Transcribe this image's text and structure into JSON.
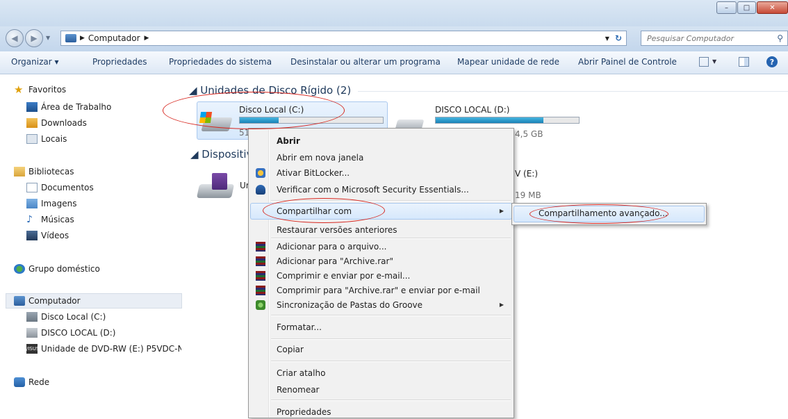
{
  "window": {
    "controls": {
      "minimize": "–",
      "maximize": "□",
      "close": "✕"
    }
  },
  "address": {
    "path": [
      "Computador"
    ],
    "search_placeholder": "Pesquisar Computador"
  },
  "toolbar": {
    "organize": "Organizar ▾",
    "properties": "Propriedades",
    "system_properties": "Propriedades do sistema",
    "uninstall": "Desinstalar ou alterar um programa",
    "map_drive": "Mapear unidade de rede",
    "control_panel": "Abrir Painel de Controle"
  },
  "nav": {
    "favorites": "Favoritos",
    "desktop": "Área de Trabalho",
    "downloads": "Downloads",
    "places": "Locais",
    "libraries": "Bibliotecas",
    "documents": "Documentos",
    "images": "Imagens",
    "music": "Músicas",
    "videos": "Vídeos",
    "homegroup": "Grupo doméstico",
    "computer": "Computador",
    "drive_c": "Disco Local (C:)",
    "drive_d": "DISCO LOCAL (D:)",
    "drive_e": "Unidade de DVD-RW (E:) P5VDC-N",
    "network": "Rede"
  },
  "content": {
    "hard_drives_header": "◢ Unidades de Disco Rígido (2)",
    "removable_header": "◢ Dispositiv",
    "drive_c": {
      "name": "Disco Local (C:)",
      "free_partial": "51",
      "usage_fraction": 0.27
    },
    "drive_d": {
      "name": "DISCO LOCAL (D:)",
      "free_partial": "4,5 GB",
      "usage_fraction": 0.75
    },
    "dvd": {
      "name_partial": "Ur",
      "label_partial": "V (E:)",
      "size_partial": "19 MB"
    }
  },
  "context_menu": {
    "items": [
      "Abrir",
      "Abrir em nova janela",
      "Ativar BitLocker...",
      "Verificar com o Microsoft Security Essentials...",
      "Compartilhar com",
      "Restaurar versões anteriores",
      "Adicionar para o arquivo...",
      "Adicionar para \"Archive.rar\"",
      "Comprimir e enviar por e-mail...",
      "Comprimir para \"Archive.rar\" e enviar por e-mail",
      "Sincronização de Pastas do Groove",
      "Formatar...",
      "Copiar",
      "Criar atalho",
      "Renomear",
      "Propriedades"
    ],
    "submenu": [
      "Compartilhamento avançado..."
    ]
  },
  "colors": {
    "annotation": "#d7261e",
    "progress": "#1a82b8"
  }
}
